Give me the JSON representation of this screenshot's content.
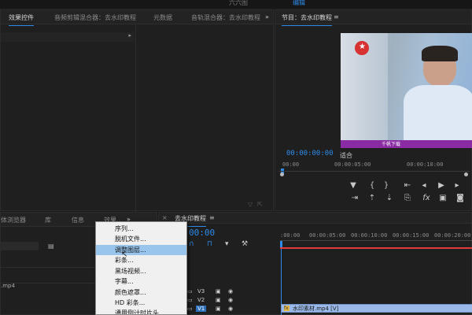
{
  "top_bar": {
    "workspace_a": "六六图",
    "workspace_b": "编辑"
  },
  "source_panel": {
    "tabs": [
      "效果控件",
      "音频剪辑混合器：去水印教程",
      "元数据",
      "音轨混合器：去水印教程"
    ]
  },
  "program_monitor": {
    "title": "节目：去水印教程",
    "menu_icon": "≡",
    "timecode": "00:00:00:00",
    "fit_label": "适合",
    "ruler_labels": [
      "00:00",
      "00:00:05:00",
      "00:00:10:00"
    ],
    "video_caption": "千帆下载"
  },
  "project_panel": {
    "tabs": [
      "体浏览器",
      "库",
      "信息",
      "效果"
    ],
    "more_icon": "»",
    "file_row": ".mp4"
  },
  "context_menu": {
    "items": [
      "序列...",
      "脱机文件...",
      "调整图层...",
      "彩条...",
      "黑场视频...",
      "字幕...",
      "颜色遮罩...",
      "HD 彩条...",
      "通用倒计时片头..."
    ],
    "highlighted_index": 2
  },
  "timeline": {
    "title": "去水印教程",
    "menu_icon": "≡",
    "timecode": "00:00",
    "ruler_labels": [
      ":00:00",
      "00:00:05:00",
      "00:00:10:00",
      "00:00:15:00",
      "00:00:20:00"
    ],
    "tracks": [
      "V3",
      "V2",
      "V1"
    ],
    "clip_label": "水印素材.mp4 [V]"
  },
  "colors": {
    "accent": "#2d8ceb",
    "playhead": "#e23b3b",
    "clip": "#9ab9e8",
    "menu_highlight": "#99c4ec"
  }
}
